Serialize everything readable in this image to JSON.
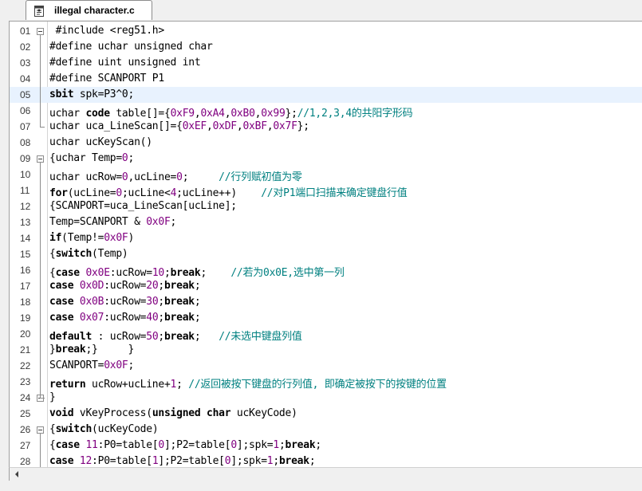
{
  "tab": {
    "title": "illegal character.c",
    "icon": "c-file-icon"
  },
  "editor": {
    "highlight_line": "05",
    "fold_markers": [
      "01",
      "09",
      "24",
      "26"
    ],
    "lines": [
      {
        "n": "01",
        "segs": [
          {
            "t": " #include <reg51.h>",
            "c": "p"
          }
        ]
      },
      {
        "n": "02",
        "segs": [
          {
            "t": "#define uchar unsigned char",
            "c": "p"
          }
        ]
      },
      {
        "n": "03",
        "segs": [
          {
            "t": "#define uint unsigned int",
            "c": "p"
          }
        ]
      },
      {
        "n": "04",
        "segs": [
          {
            "t": "#define SCANPORT P1",
            "c": "p"
          }
        ]
      },
      {
        "n": "05",
        "segs": [
          {
            "t": "sbit",
            "c": "kw"
          },
          {
            "t": " spk=P3^0;",
            "c": "p"
          }
        ]
      },
      {
        "n": "06",
        "segs": [
          {
            "t": "uchar ",
            "c": "p"
          },
          {
            "t": "code",
            "c": "kw"
          },
          {
            "t": " table[]={",
            "c": "p"
          },
          {
            "t": "0xF9",
            "c": "num"
          },
          {
            "t": ",",
            "c": "p"
          },
          {
            "t": "0xA4",
            "c": "num"
          },
          {
            "t": ",",
            "c": "p"
          },
          {
            "t": "0xB0",
            "c": "num"
          },
          {
            "t": ",",
            "c": "p"
          },
          {
            "t": "0x99",
            "c": "num"
          },
          {
            "t": "};",
            "c": "p"
          },
          {
            "t": "//1,2,3,4的共阳字形码",
            "c": "cm"
          }
        ]
      },
      {
        "n": "07",
        "segs": [
          {
            "t": "uchar uca_LineScan[]={",
            "c": "p"
          },
          {
            "t": "0xEF",
            "c": "num"
          },
          {
            "t": ",",
            "c": "p"
          },
          {
            "t": "0xDF",
            "c": "num"
          },
          {
            "t": ",",
            "c": "p"
          },
          {
            "t": "0xBF",
            "c": "num"
          },
          {
            "t": ",",
            "c": "p"
          },
          {
            "t": "0x7F",
            "c": "num"
          },
          {
            "t": "};",
            "c": "p"
          }
        ]
      },
      {
        "n": "08",
        "segs": [
          {
            "t": "uchar ucKeyScan()",
            "c": "p"
          }
        ]
      },
      {
        "n": "09",
        "segs": [
          {
            "t": "{uchar Temp=",
            "c": "p"
          },
          {
            "t": "0",
            "c": "num"
          },
          {
            "t": ";",
            "c": "p"
          }
        ]
      },
      {
        "n": "10",
        "segs": [
          {
            "t": "uchar ucRow=",
            "c": "p"
          },
          {
            "t": "0",
            "c": "num"
          },
          {
            "t": ",ucLine=",
            "c": "p"
          },
          {
            "t": "0",
            "c": "num"
          },
          {
            "t": ";     ",
            "c": "p"
          },
          {
            "t": "//行列赋初值为零",
            "c": "cm"
          }
        ]
      },
      {
        "n": "11",
        "segs": [
          {
            "t": "for",
            "c": "kw"
          },
          {
            "t": "(ucLine=",
            "c": "p"
          },
          {
            "t": "0",
            "c": "num"
          },
          {
            "t": ";ucLine<",
            "c": "p"
          },
          {
            "t": "4",
            "c": "num"
          },
          {
            "t": ";ucLine++)    ",
            "c": "p"
          },
          {
            "t": "//对P1端口扫描来确定键盘行值",
            "c": "cm"
          }
        ]
      },
      {
        "n": "12",
        "segs": [
          {
            "t": "{SCANPORT=uca_LineScan[ucLine];",
            "c": "p"
          }
        ]
      },
      {
        "n": "13",
        "segs": [
          {
            "t": "Temp=SCANPORT & ",
            "c": "p"
          },
          {
            "t": "0x0F",
            "c": "num"
          },
          {
            "t": ";",
            "c": "p"
          }
        ]
      },
      {
        "n": "14",
        "segs": [
          {
            "t": "if",
            "c": "kw"
          },
          {
            "t": "(Temp!=",
            "c": "p"
          },
          {
            "t": "0x0F",
            "c": "num"
          },
          {
            "t": ")",
            "c": "p"
          }
        ]
      },
      {
        "n": "15",
        "segs": [
          {
            "t": "{",
            "c": "p"
          },
          {
            "t": "switch",
            "c": "kw"
          },
          {
            "t": "(Temp)",
            "c": "p"
          }
        ]
      },
      {
        "n": "16",
        "segs": [
          {
            "t": "{",
            "c": "p"
          },
          {
            "t": "case",
            "c": "kw"
          },
          {
            "t": " ",
            "c": "p"
          },
          {
            "t": "0x0E",
            "c": "num"
          },
          {
            "t": ":ucRow=",
            "c": "p"
          },
          {
            "t": "10",
            "c": "num"
          },
          {
            "t": ";",
            "c": "p"
          },
          {
            "t": "break",
            "c": "kw"
          },
          {
            "t": ";    ",
            "c": "p"
          },
          {
            "t": "//若为0x0E,选中第一列",
            "c": "cm"
          }
        ]
      },
      {
        "n": "17",
        "segs": [
          {
            "t": "case",
            "c": "kw"
          },
          {
            "t": " ",
            "c": "p"
          },
          {
            "t": "0x0D",
            "c": "num"
          },
          {
            "t": ":ucRow=",
            "c": "p"
          },
          {
            "t": "20",
            "c": "num"
          },
          {
            "t": ";",
            "c": "p"
          },
          {
            "t": "break",
            "c": "kw"
          },
          {
            "t": ";",
            "c": "p"
          }
        ]
      },
      {
        "n": "18",
        "segs": [
          {
            "t": "case",
            "c": "kw"
          },
          {
            "t": " ",
            "c": "p"
          },
          {
            "t": "0x0B",
            "c": "num"
          },
          {
            "t": ":ucRow=",
            "c": "p"
          },
          {
            "t": "30",
            "c": "num"
          },
          {
            "t": ";",
            "c": "p"
          },
          {
            "t": "break",
            "c": "kw"
          },
          {
            "t": ";",
            "c": "p"
          }
        ]
      },
      {
        "n": "19",
        "segs": [
          {
            "t": "case",
            "c": "kw"
          },
          {
            "t": " ",
            "c": "p"
          },
          {
            "t": "0x07",
            "c": "num"
          },
          {
            "t": ":ucRow=",
            "c": "p"
          },
          {
            "t": "40",
            "c": "num"
          },
          {
            "t": ";",
            "c": "p"
          },
          {
            "t": "break",
            "c": "kw"
          },
          {
            "t": ";",
            "c": "p"
          }
        ]
      },
      {
        "n": "20",
        "segs": [
          {
            "t": "default",
            "c": "kw"
          },
          {
            "t": " : ucRow=",
            "c": "p"
          },
          {
            "t": "50",
            "c": "num"
          },
          {
            "t": ";",
            "c": "p"
          },
          {
            "t": "break",
            "c": "kw"
          },
          {
            "t": ";   ",
            "c": "p"
          },
          {
            "t": "//未选中键盘列值",
            "c": "cm"
          }
        ]
      },
      {
        "n": "21",
        "segs": [
          {
            "t": "}",
            "c": "p"
          },
          {
            "t": "break",
            "c": "kw"
          },
          {
            "t": ";}     }",
            "c": "p"
          }
        ]
      },
      {
        "n": "22",
        "segs": [
          {
            "t": "SCANPORT=",
            "c": "p"
          },
          {
            "t": "0x0F",
            "c": "num"
          },
          {
            "t": ";",
            "c": "p"
          }
        ]
      },
      {
        "n": "23",
        "segs": [
          {
            "t": "return",
            "c": "kw"
          },
          {
            "t": " ucRow+ucLine+",
            "c": "p"
          },
          {
            "t": "1",
            "c": "num"
          },
          {
            "t": "; ",
            "c": "p"
          },
          {
            "t": "//返回被按下键盘的行列值, 即确定被按下的按键的位置",
            "c": "cm"
          }
        ]
      },
      {
        "n": "24",
        "segs": [
          {
            "t": "}",
            "c": "p"
          }
        ]
      },
      {
        "n": "25",
        "segs": [
          {
            "t": "void",
            "c": "kw"
          },
          {
            "t": " vKeyProcess(",
            "c": "p"
          },
          {
            "t": "unsigned char",
            "c": "kw"
          },
          {
            "t": " ucKeyCode)",
            "c": "p"
          }
        ]
      },
      {
        "n": "26",
        "segs": [
          {
            "t": "{",
            "c": "p"
          },
          {
            "t": "switch",
            "c": "kw"
          },
          {
            "t": "(ucKeyCode)",
            "c": "p"
          }
        ]
      },
      {
        "n": "27",
        "segs": [
          {
            "t": "{",
            "c": "p"
          },
          {
            "t": "case",
            "c": "kw"
          },
          {
            "t": " ",
            "c": "p"
          },
          {
            "t": "11",
            "c": "num"
          },
          {
            "t": ":P0=table[",
            "c": "p"
          },
          {
            "t": "0",
            "c": "num"
          },
          {
            "t": "];P2=table[",
            "c": "p"
          },
          {
            "t": "0",
            "c": "num"
          },
          {
            "t": "];spk=",
            "c": "p"
          },
          {
            "t": "1",
            "c": "num"
          },
          {
            "t": ";",
            "c": "p"
          },
          {
            "t": "break",
            "c": "kw"
          },
          {
            "t": ";",
            "c": "p"
          }
        ]
      },
      {
        "n": "28",
        "segs": [
          {
            "t": "case",
            "c": "kw"
          },
          {
            "t": " ",
            "c": "p"
          },
          {
            "t": "12",
            "c": "num"
          },
          {
            "t": ":P0=table[",
            "c": "p"
          },
          {
            "t": "1",
            "c": "num"
          },
          {
            "t": "];P2=table[",
            "c": "p"
          },
          {
            "t": "0",
            "c": "num"
          },
          {
            "t": "];spk=",
            "c": "p"
          },
          {
            "t": "1",
            "c": "num"
          },
          {
            "t": ";",
            "c": "p"
          },
          {
            "t": "break",
            "c": "kw"
          },
          {
            "t": ";",
            "c": "p"
          }
        ]
      }
    ]
  },
  "scrollbar": {
    "left_arrow_icon": "scroll-left-arrow-icon"
  }
}
